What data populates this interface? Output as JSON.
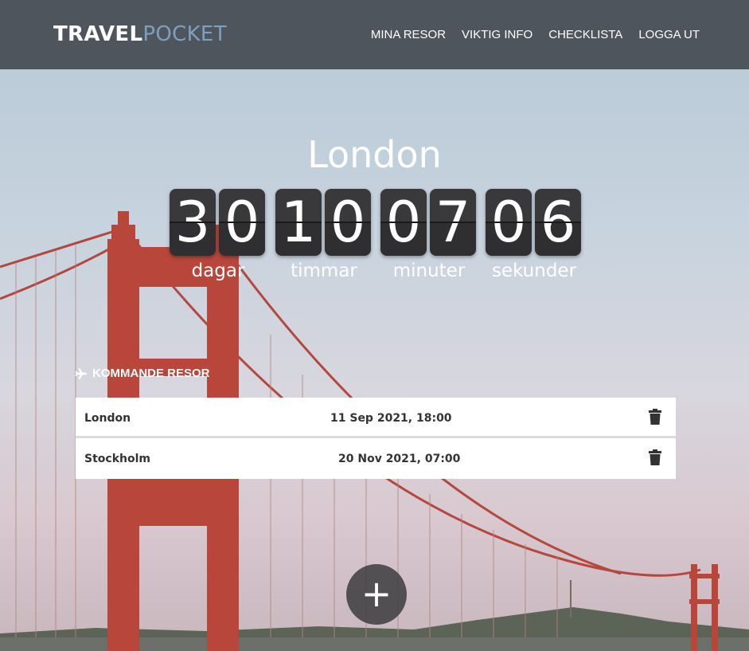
{
  "brand": {
    "part1": "TRAVEL",
    "part2": "POCKET"
  },
  "nav": [
    "MINA RESOR",
    "VIKTIG INFO",
    "CHECKLISTA",
    "LOGGA UT"
  ],
  "hero": {
    "destination": "London"
  },
  "countdown": {
    "days": {
      "digits": [
        "3",
        "0"
      ],
      "label": "dagar"
    },
    "hours": {
      "digits": [
        "1",
        "0"
      ],
      "label": "timmar"
    },
    "minutes": {
      "digits": [
        "0",
        "7"
      ],
      "label": "minuter"
    },
    "seconds": {
      "digits": [
        "0",
        "6"
      ],
      "label": "sekunder"
    }
  },
  "upcoming": {
    "title": "KOMMANDE RESOR",
    "trips": [
      {
        "name": "London",
        "date": "11 Sep 2021, 18:00"
      },
      {
        "name": "Stockholm",
        "date": "20 Nov 2021, 07:00"
      }
    ]
  },
  "add_button": {
    "label": "+"
  },
  "colors": {
    "navbar": "#4f555c",
    "brand_accent": "#7e9fbd",
    "digit_bg": "#2f2f31",
    "bridge": "#b8463a"
  },
  "icons": {
    "section": "plane-icon",
    "delete": "trash-icon"
  }
}
